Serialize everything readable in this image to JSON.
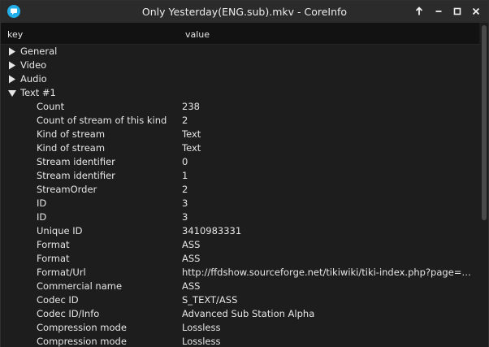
{
  "window": {
    "title": "Only Yesterday(ENG.sub).mkv - CoreInfo",
    "accent": "#22aee8",
    "icons": {
      "app": "chat-bubble-icon",
      "up": "arrow-up-icon",
      "minimize": "minimize-icon",
      "maximize": "maximize-icon",
      "close": "close-icon"
    }
  },
  "header": {
    "key_label": "key",
    "value_label": "value"
  },
  "tree": {
    "groups": [
      {
        "label": "General",
        "expanded": false
      },
      {
        "label": "Video",
        "expanded": false
      },
      {
        "label": "Audio",
        "expanded": false
      },
      {
        "label": "Text #1",
        "expanded": true
      }
    ],
    "rows": [
      {
        "key": "Count",
        "value": "238"
      },
      {
        "key": "Count of stream of this kind",
        "value": "2"
      },
      {
        "key": "Kind of stream",
        "value": "Text"
      },
      {
        "key": "Kind of stream",
        "value": "Text"
      },
      {
        "key": "Stream identifier",
        "value": "0"
      },
      {
        "key": "Stream identifier",
        "value": "1"
      },
      {
        "key": "StreamOrder",
        "value": "2"
      },
      {
        "key": "ID",
        "value": "3"
      },
      {
        "key": "ID",
        "value": "3"
      },
      {
        "key": "Unique ID",
        "value": "3410983331"
      },
      {
        "key": "Format",
        "value": "ASS"
      },
      {
        "key": "Format",
        "value": "ASS"
      },
      {
        "key": "Format/Url",
        "value": "http://ffdshow.sourceforge.net/tikiwiki/tiki-index.php?page=Getti..."
      },
      {
        "key": "Commercial name",
        "value": "ASS"
      },
      {
        "key": "Codec ID",
        "value": "S_TEXT/ASS"
      },
      {
        "key": "Codec ID/Info",
        "value": "Advanced Sub Station Alpha"
      },
      {
        "key": "Compression mode",
        "value": "Lossless"
      },
      {
        "key": "Compression mode",
        "value": "Lossless"
      }
    ]
  }
}
